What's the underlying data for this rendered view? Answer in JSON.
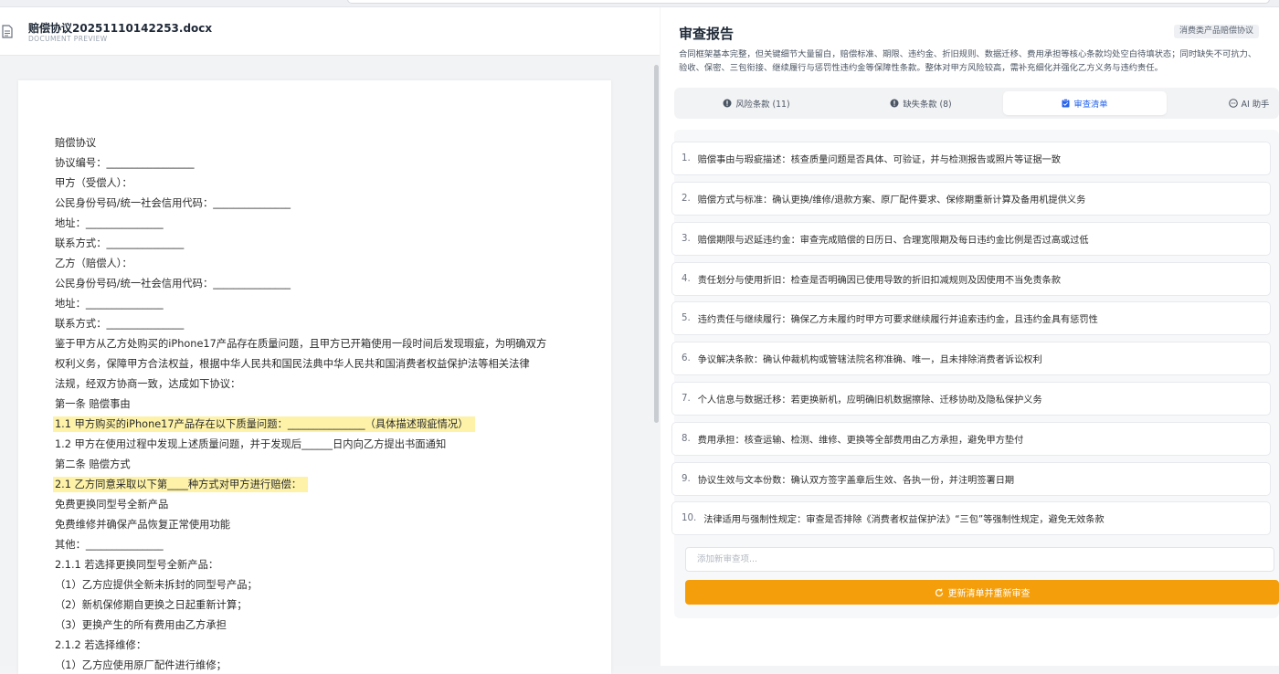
{
  "document": {
    "filename": "赔偿协议20251110142253.docx",
    "subtitle": "DOCUMENT PREVIEW",
    "lines": [
      "赔偿协议",
      "协议编号：_________________",
      "甲方（受偿人）：",
      "公民身份号码/统一社会信用代码：_______________",
      "地址：_______________",
      "联系方式：_______________",
      "乙方（赔偿人）：",
      "公民身份号码/统一社会信用代码：_______________",
      "地址：_______________",
      "联系方式：_______________",
      "鉴于甲方从乙方处购买的iPhone17产品存在质量问题，且甲方已开箱使用一段时间后发现瑕疵，为明确双方",
      "权利义务，保障甲方合法权益，根据中华人民共和国民法典中华人民共和国消费者权益保护法等相关法律",
      "法规，经双方协商一致，达成如下协议：",
      "第一条 赔偿事由",
      "1.1 甲方购买的iPhone17产品存在以下质量问题：_______________（具体描述瑕疵情况）",
      "1.2 甲方在使用过程中发现上述质量问题，并于发现后______日内向乙方提出书面通知",
      "第二条 赔偿方式",
      "2.1 乙方同意采取以下第____种方式对甲方进行赔偿：",
      "  免费更换同型号全新产品",
      "  免费维修并确保产品恢复正常使用功能",
      "  其他：_______________",
      "2.1.1 若选择更换同型号全新产品：",
      "（1）乙方应提供全新未拆封的同型号产品；",
      "（2）新机保修期自更换之日起重新计算；",
      "（3）更换产生的所有费用由乙方承担",
      "2.1.2 若选择维修：",
      "（1）乙方应使用原厂配件进行维修；"
    ]
  },
  "report": {
    "title": "审查报告",
    "tag": "消费类产品赔偿协议",
    "summary": "合同框架基本完整，但关键细节大量留白，赔偿标准、期限、违约金、折旧规则、数据迁移、费用承担等核心条款均处空白待填状态；同时缺失不可抗力、验收、保密、三包衔接、继续履行与惩罚性违约金等保障性条款。整体对甲方风险较高，需补充细化并强化乙方义务与违约责任。",
    "tabs": [
      {
        "label": "风险条款 (11)",
        "icon": "alert-icon"
      },
      {
        "label": "缺失条款 (8)",
        "icon": "alert-icon"
      },
      {
        "label": "审查清单",
        "icon": "clipboard-icon"
      },
      {
        "label": "AI 助手",
        "icon": "chat-icon"
      }
    ],
    "checklist": [
      {
        "num": "1.",
        "text": "赔偿事由与瑕疵描述：核查质量问题是否具体、可验证，并与检测报告或照片等证据一致"
      },
      {
        "num": "2.",
        "text": "赔偿方式与标准：确认更换/维修/退款方案、原厂配件要求、保修期重新计算及备用机提供义务"
      },
      {
        "num": "3.",
        "text": "赔偿期限与迟延违约金：审查完成赔偿的日历日、合理宽限期及每日违约金比例是否过高或过低"
      },
      {
        "num": "4.",
        "text": "责任划分与使用折旧：检查是否明确因已使用导致的折旧扣减规则及因使用不当免责条款"
      },
      {
        "num": "5.",
        "text": "违约责任与继续履行：确保乙方未履约时甲方可要求继续履行并追索违约金，且违约金具有惩罚性"
      },
      {
        "num": "6.",
        "text": "争议解决条款：确认仲裁机构或管辖法院名称准确、唯一，且未排除消费者诉讼权利"
      },
      {
        "num": "7.",
        "text": "个人信息与数据迁移：若更换新机，应明确旧机数据擦除、迁移协助及隐私保护义务"
      },
      {
        "num": "8.",
        "text": "费用承担：核查运输、检测、维修、更换等全部费用由乙方承担，避免甲方垫付"
      },
      {
        "num": "9.",
        "text": "协议生效与文本份数：确认双方签字盖章后生效、各执一份，并注明签署日期"
      },
      {
        "num": "10.",
        "text": "法律适用与强制性规定：审查是否排除《消费者权益保护法》“三包”等强制性规定，避免无效条款"
      }
    ],
    "add_placeholder": "添加新审查项...",
    "update_button": "更新清单并重新审查",
    "accent_color": "#f59e0b",
    "active_tab_color": "#2563eb"
  }
}
